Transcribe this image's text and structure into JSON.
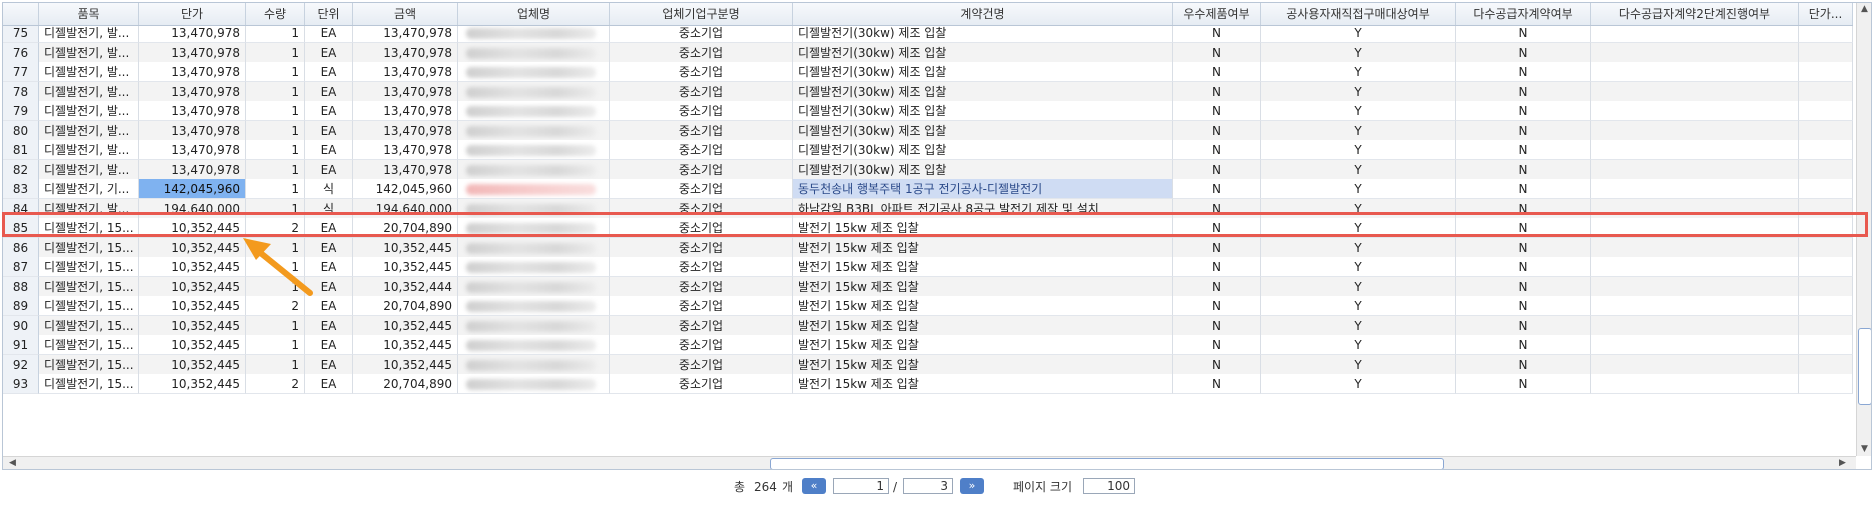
{
  "columns": [
    "",
    "품목",
    "단가",
    "수량",
    "단위",
    "금액",
    "업체명",
    "업체기업구분명",
    "계약건명",
    "우수제품여부",
    "공사용자재직접구매대상여부",
    "다수공급자계약여부",
    "다수공급자계약2단계진행여부",
    "단가..."
  ],
  "rows": [
    {
      "idx": "75",
      "item": "디젤발전기, 발...",
      "price": "13,470,978",
      "qty": "1",
      "unit": "EA",
      "amount": "13,470,978",
      "company_type": "중소기업",
      "contract": "디젤발전기(30kw) 제조 입찰",
      "excellent": "N",
      "direct": "Y",
      "multi": "N"
    },
    {
      "idx": "76",
      "item": "디젤발전기, 발...",
      "price": "13,470,978",
      "qty": "1",
      "unit": "EA",
      "amount": "13,470,978",
      "company_type": "중소기업",
      "contract": "디젤발전기(30kw) 제조 입찰",
      "excellent": "N",
      "direct": "Y",
      "multi": "N"
    },
    {
      "idx": "77",
      "item": "디젤발전기, 발...",
      "price": "13,470,978",
      "qty": "1",
      "unit": "EA",
      "amount": "13,470,978",
      "company_type": "중소기업",
      "contract": "디젤발전기(30kw) 제조 입찰",
      "excellent": "N",
      "direct": "Y",
      "multi": "N"
    },
    {
      "idx": "78",
      "item": "디젤발전기, 발...",
      "price": "13,470,978",
      "qty": "1",
      "unit": "EA",
      "amount": "13,470,978",
      "company_type": "중소기업",
      "contract": "디젤발전기(30kw) 제조 입찰",
      "excellent": "N",
      "direct": "Y",
      "multi": "N"
    },
    {
      "idx": "79",
      "item": "디젤발전기, 발...",
      "price": "13,470,978",
      "qty": "1",
      "unit": "EA",
      "amount": "13,470,978",
      "company_type": "중소기업",
      "contract": "디젤발전기(30kw) 제조 입찰",
      "excellent": "N",
      "direct": "Y",
      "multi": "N"
    },
    {
      "idx": "80",
      "item": "디젤발전기, 발...",
      "price": "13,470,978",
      "qty": "1",
      "unit": "EA",
      "amount": "13,470,978",
      "company_type": "중소기업",
      "contract": "디젤발전기(30kw) 제조 입찰",
      "excellent": "N",
      "direct": "Y",
      "multi": "N"
    },
    {
      "idx": "81",
      "item": "디젤발전기, 발...",
      "price": "13,470,978",
      "qty": "1",
      "unit": "EA",
      "amount": "13,470,978",
      "company_type": "중소기업",
      "contract": "디젤발전기(30kw) 제조 입찰",
      "excellent": "N",
      "direct": "Y",
      "multi": "N"
    },
    {
      "idx": "82",
      "item": "디젤발전기, 발...",
      "price": "13,470,978",
      "qty": "1",
      "unit": "EA",
      "amount": "13,470,978",
      "company_type": "중소기업",
      "contract": "디젤발전기(30kw) 제조 입찰",
      "excellent": "N",
      "direct": "Y",
      "multi": "N"
    },
    {
      "idx": "83",
      "item": "디젤발전기, 기...",
      "price": "142,045,960",
      "qty": "1",
      "unit": "식",
      "amount": "142,045,960",
      "company_type": "중소기업",
      "contract": "동두천송내 행복주택 1공구 전기공사-디젤발전기",
      "excellent": "N",
      "direct": "Y",
      "multi": "N"
    },
    {
      "idx": "84",
      "item": "디젤발전기, 발...",
      "price": "194,640,000",
      "qty": "1",
      "unit": "식",
      "amount": "194,640,000",
      "company_type": "중소기업",
      "contract": "하남감일 B3BL 아파트 전기공사 8공구 발전기 제작 및 설치",
      "excellent": "N",
      "direct": "Y",
      "multi": "N"
    },
    {
      "idx": "85",
      "item": "디젤발전기, 15...",
      "price": "10,352,445",
      "qty": "2",
      "unit": "EA",
      "amount": "20,704,890",
      "company_type": "중소기업",
      "contract": "발전기 15kw 제조 입찰",
      "excellent": "N",
      "direct": "Y",
      "multi": "N"
    },
    {
      "idx": "86",
      "item": "디젤발전기, 15...",
      "price": "10,352,445",
      "qty": "1",
      "unit": "EA",
      "amount": "10,352,445",
      "company_type": "중소기업",
      "contract": "발전기 15kw 제조 입찰",
      "excellent": "N",
      "direct": "Y",
      "multi": "N"
    },
    {
      "idx": "87",
      "item": "디젤발전기, 15...",
      "price": "10,352,445",
      "qty": "1",
      "unit": "EA",
      "amount": "10,352,445",
      "company_type": "중소기업",
      "contract": "발전기 15kw 제조 입찰",
      "excellent": "N",
      "direct": "Y",
      "multi": "N"
    },
    {
      "idx": "88",
      "item": "디젤발전기, 15...",
      "price": "10,352,445",
      "qty": "1",
      "unit": "EA",
      "amount": "10,352,444",
      "company_type": "중소기업",
      "contract": "발전기 15kw 제조 입찰",
      "excellent": "N",
      "direct": "Y",
      "multi": "N"
    },
    {
      "idx": "89",
      "item": "디젤발전기, 15...",
      "price": "10,352,445",
      "qty": "2",
      "unit": "EA",
      "amount": "20,704,890",
      "company_type": "중소기업",
      "contract": "발전기 15kw 제조 입찰",
      "excellent": "N",
      "direct": "Y",
      "multi": "N"
    },
    {
      "idx": "90",
      "item": "디젤발전기, 15...",
      "price": "10,352,445",
      "qty": "1",
      "unit": "EA",
      "amount": "10,352,445",
      "company_type": "중소기업",
      "contract": "발전기 15kw 제조 입찰",
      "excellent": "N",
      "direct": "Y",
      "multi": "N"
    },
    {
      "idx": "91",
      "item": "디젤발전기, 15...",
      "price": "10,352,445",
      "qty": "1",
      "unit": "EA",
      "amount": "10,352,445",
      "company_type": "중소기업",
      "contract": "발전기 15kw 제조 입찰",
      "excellent": "N",
      "direct": "Y",
      "multi": "N"
    },
    {
      "idx": "92",
      "item": "디젤발전기, 15...",
      "price": "10,352,445",
      "qty": "1",
      "unit": "EA",
      "amount": "10,352,445",
      "company_type": "중소기업",
      "contract": "발전기 15kw 제조 입찰",
      "excellent": "N",
      "direct": "Y",
      "multi": "N"
    },
    {
      "idx": "93",
      "item": "디젤발전기, 15...",
      "price": "10,352,445",
      "qty": "2",
      "unit": "EA",
      "amount": "20,704,890",
      "company_type": "중소기업",
      "contract": "발전기 15kw 제조 입찰",
      "excellent": "N",
      "direct": "Y",
      "multi": "N"
    }
  ],
  "highlighted_row": "83",
  "footer": {
    "total_prefix": "총",
    "total_count": "264",
    "total_suffix": "개",
    "prev_label": "«",
    "next_label": "»",
    "current_page": "1",
    "page_separator": "/",
    "total_pages": "3",
    "page_size_label": "페이지 크기",
    "page_size": "100"
  },
  "colors": {
    "highlight_border": "#e8594f",
    "selected_cell": "#7fb2f0",
    "arrow": "#f39a1e",
    "pager_button": "#4f7fc8"
  }
}
